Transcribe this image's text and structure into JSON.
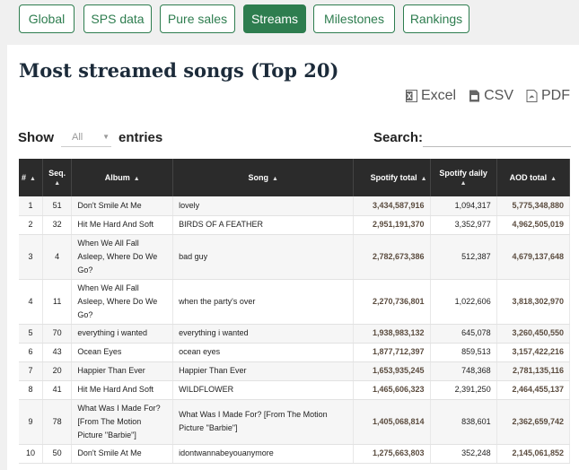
{
  "tabs": [
    {
      "label": "Global"
    },
    {
      "label": "SPS data"
    },
    {
      "label": "Pure sales"
    },
    {
      "label": "Streams"
    },
    {
      "label": "Milestones"
    },
    {
      "label": "Rankings"
    }
  ],
  "title": "Most streamed songs (Top 20)",
  "exports": {
    "excel": "Excel",
    "csv": "CSV",
    "pdf": "PDF"
  },
  "show_label": "Show",
  "entries_value": "All",
  "entries_label": "entries",
  "search_label": "Search:",
  "columns": [
    "#",
    "Seq.",
    "Album",
    "Song",
    "Spotify total",
    "Spotify daily",
    "AOD total"
  ],
  "rows": [
    [
      "1",
      "51",
      "Don't Smile At Me",
      "lovely",
      "3,434,587,916",
      "1,094,317",
      "5,775,348,880"
    ],
    [
      "2",
      "32",
      "Hit Me Hard And Soft",
      "BIRDS OF A FEATHER",
      "2,951,191,370",
      "3,352,977",
      "4,962,505,019"
    ],
    [
      "3",
      "4",
      "When We All Fall Asleep, Where Do We Go?",
      "bad guy",
      "2,782,673,386",
      "512,387",
      "4,679,137,648"
    ],
    [
      "4",
      "11",
      "When We All Fall Asleep, Where Do We Go?",
      "when the party's over",
      "2,270,736,801",
      "1,022,606",
      "3,818,302,970"
    ],
    [
      "5",
      "70",
      "everything i wanted",
      "everything i wanted",
      "1,938,983,132",
      "645,078",
      "3,260,450,550"
    ],
    [
      "6",
      "43",
      "Ocean Eyes",
      "ocean eyes",
      "1,877,712,397",
      "859,513",
      "3,157,422,216"
    ],
    [
      "7",
      "20",
      "Happier Than Ever",
      "Happier Than Ever",
      "1,653,935,245",
      "748,368",
      "2,781,135,116"
    ],
    [
      "8",
      "41",
      "Hit Me Hard And Soft",
      "WILDFLOWER",
      "1,465,606,323",
      "2,391,250",
      "2,464,455,137"
    ],
    [
      "9",
      "78",
      "What Was I Made For? [From The Motion Picture \"Barbie\"]",
      "What Was I Made For? [From The Motion Picture \"Barbie\"]",
      "1,405,068,814",
      "838,601",
      "2,362,659,742"
    ],
    [
      "10",
      "50",
      "Don't Smile At Me",
      "idontwannabeyouanymore",
      "1,275,663,803",
      "352,248",
      "2,145,061,852"
    ]
  ],
  "colors": {
    "accent": "#2e7d4f",
    "header_bg": "#2b2b2b",
    "number_text": "#5b4c3f"
  }
}
